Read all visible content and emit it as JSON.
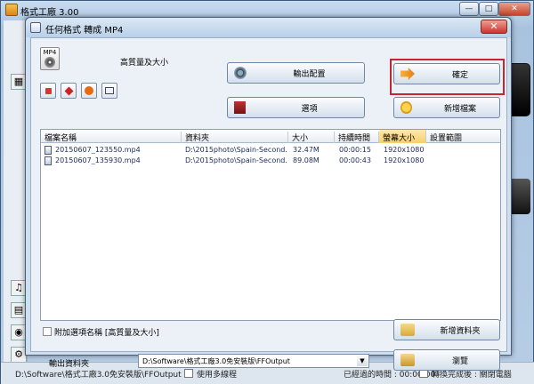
{
  "main_window": {
    "title": "格式工廠 3.00",
    "min_label": "—",
    "max_label": "□",
    "close_label": "✕"
  },
  "dialog": {
    "title": "任何格式 轉成 MP4",
    "close_label": "✕",
    "format_icon_text": "MP4",
    "quality_label": "高質量及大小",
    "buttons": {
      "output_config": "輸出配置",
      "ok": "確定",
      "options": "選項",
      "add_file": "新增檔案",
      "add_folder": "新增資料夾",
      "browse": "瀏覽"
    },
    "table": {
      "headers": [
        "檔案名稱",
        "資料夾",
        "大小",
        "持續時間",
        "螢幕大小",
        "設置範圍"
      ],
      "rows": [
        {
          "name": "20150607_123550.mp4",
          "folder": "D:\\2015photo\\Spain-Second...",
          "size": "32.47M",
          "duration": "00:00:15",
          "screen": "1920x1080",
          "range": ""
        },
        {
          "name": "20150607_135930.mp4",
          "folder": "D:\\2015photo\\Spain-Second...",
          "size": "89.08M",
          "duration": "00:00:43",
          "screen": "1920x1080",
          "range": ""
        }
      ]
    },
    "append_option_label": "附加選項名稱 [高質量及大小]",
    "output_folder_label": "輸出資料夾",
    "output_folder_value": "D:\\Software\\格式工廠3.0免安裝版\\FFOutput"
  },
  "status_bar": {
    "path": "D:\\Software\\格式工廠3.0免安裝版\\FFOutput",
    "multithread_label": "使用多線程",
    "elapsed": "已經過的時間 : 00:00:00",
    "shutdown": "轉換完成後 : 關閉電腦"
  },
  "colors": {
    "highlight_frame": "#c8262e",
    "sorted_header": "#f6cf6b"
  }
}
